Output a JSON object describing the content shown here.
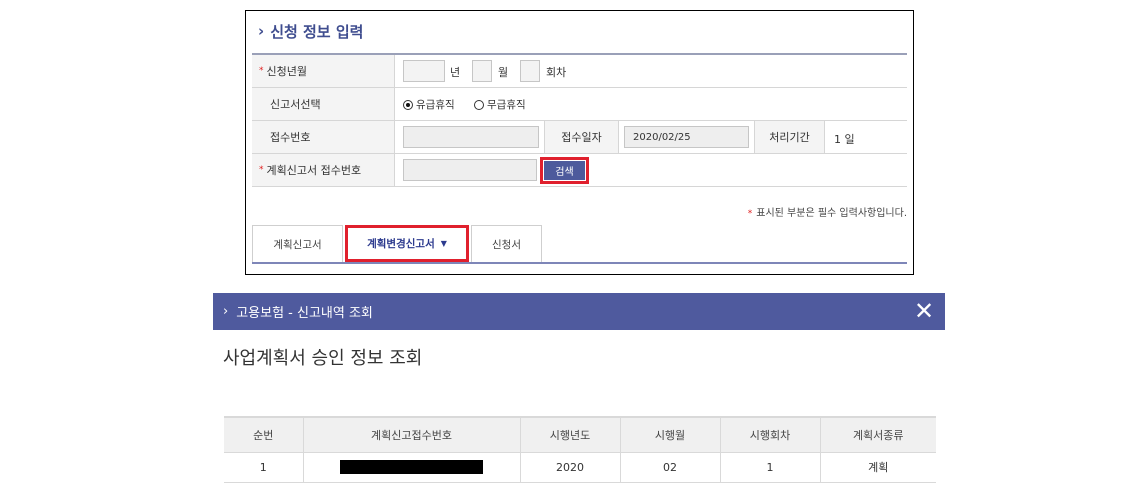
{
  "form": {
    "title": "신청 정보 입력",
    "chevron": "›",
    "required_mark": "*",
    "rows": {
      "period_label": "신청년월",
      "year_unit": "년",
      "month_unit": "월",
      "round_unit": "회차",
      "report_type_label": "신고서선택",
      "radio_paid": "유급휴직",
      "radio_unpaid": "무급휴직",
      "receipt_no_label": "접수번호",
      "receipt_date_label": "접수일자",
      "receipt_date_value": "2020/02/25",
      "processing_label": "처리기간",
      "processing_value": "1  일",
      "plan_receipt_label": "계획신고서 접수번호",
      "search_button": "검색"
    },
    "note": "표시된 부분은 필수 입력사항입니다.",
    "tabs": [
      {
        "label": "계획신고서"
      },
      {
        "label": "계획변경신고서",
        "caret": "▼"
      },
      {
        "label": "신청서"
      }
    ]
  },
  "dialog": {
    "bar_title": "고용보험 - 신고내역 조회",
    "close_icon": "✕",
    "heading": "사업계획서 승인 정보 조회",
    "table": {
      "headers": [
        "순번",
        "계획신고접수번호",
        "시행년도",
        "시행월",
        "시행회차",
        "계획서종류"
      ],
      "rows": [
        {
          "seq": "1",
          "year": "2020",
          "month": "02",
          "round": "1",
          "kind": "계획"
        }
      ]
    }
  },
  "colors": {
    "accent": "#4f5a9e",
    "highlight": "#e0202d",
    "required": "#e02020"
  }
}
